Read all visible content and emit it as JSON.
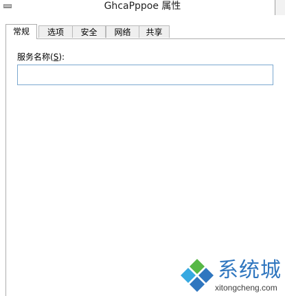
{
  "window": {
    "title": "GhcaPppoe 属性"
  },
  "tabs": [
    {
      "label": "常规",
      "active": true
    },
    {
      "label": "选项",
      "active": false
    },
    {
      "label": "安全",
      "active": false
    },
    {
      "label": "网络",
      "active": false
    },
    {
      "label": "共享",
      "active": false
    }
  ],
  "general": {
    "service_name_label_prefix": "服务名称(",
    "service_name_label_hotkey": "S",
    "service_name_label_suffix": "):",
    "service_name_value": ""
  },
  "watermark": {
    "name": "系统城",
    "domain": "xitongcheng.com",
    "colors": {
      "blue": "#2f76bf",
      "green": "#57b846",
      "cyan": "#37a9e1"
    }
  }
}
